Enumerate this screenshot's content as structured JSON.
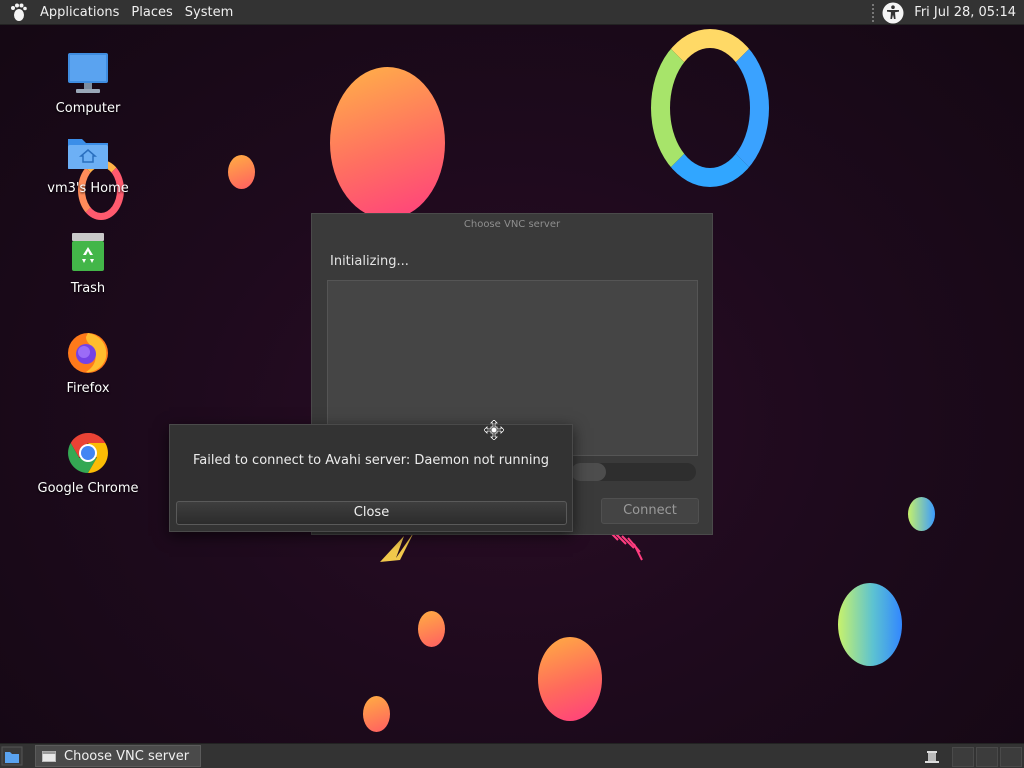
{
  "top_panel": {
    "menus": [
      "Applications",
      "Places",
      "System"
    ],
    "clock": "Fri Jul 28, 05:14",
    "icons": {
      "logo": "gnome-foot-icon",
      "accessibility": "accessibility-icon"
    }
  },
  "desktop": {
    "icons": [
      {
        "label": "Computer",
        "icon": "computer-icon"
      },
      {
        "label": "vm3's Home",
        "icon": "home-folder-icon"
      },
      {
        "label": "Trash",
        "icon": "trash-icon"
      },
      {
        "label": "Firefox",
        "icon": "firefox-icon"
      },
      {
        "label": "Google Chrome",
        "icon": "chrome-icon"
      }
    ]
  },
  "vnc_dialog": {
    "title": "Choose VNC server",
    "status": "Initializing...",
    "progress": 0.28,
    "connect_label": "Connect"
  },
  "error_dialog": {
    "message": "Failed to connect to Avahi server: Daemon not running",
    "close_label": "Close"
  },
  "taskbar": {
    "task_label": "Choose VNC server"
  },
  "colors": {
    "panel": "#333333",
    "dialog": "#3a3a3a",
    "wallpaper": "#1e0a1d"
  }
}
